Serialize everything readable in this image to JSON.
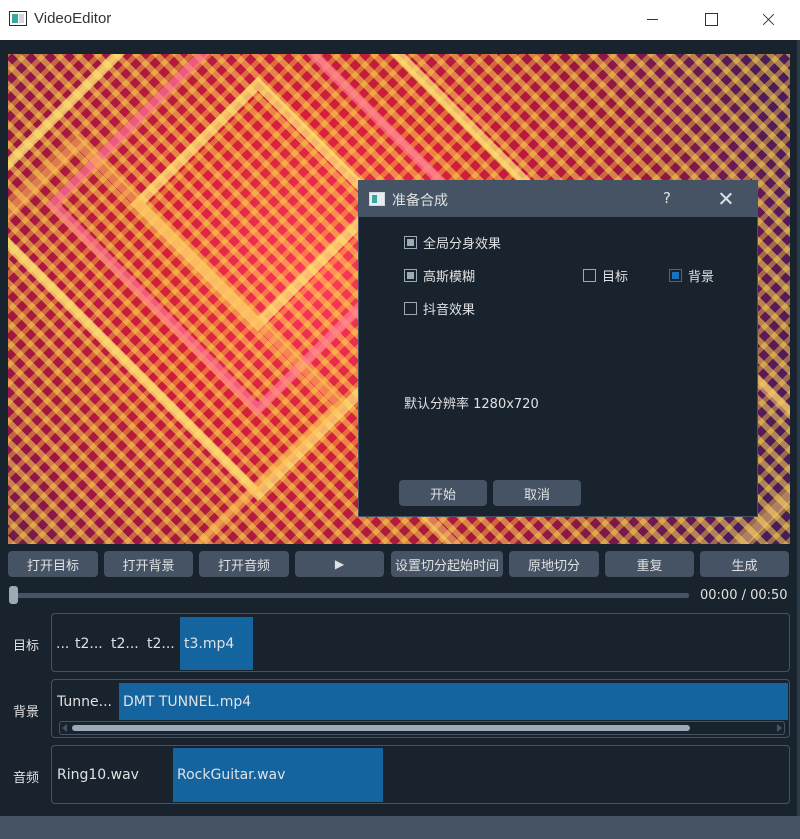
{
  "window": {
    "title": "VideoEditor"
  },
  "dialog": {
    "title": "准备合成",
    "help": "?",
    "checkboxes": [
      {
        "label": "全局分身效果",
        "state": "partial"
      },
      {
        "label": "高斯模糊",
        "state": "partial"
      },
      {
        "label": "目标",
        "state": "unchecked"
      },
      {
        "label": "背景",
        "state": "checked"
      },
      {
        "label": "抖音效果",
        "state": "unchecked"
      }
    ],
    "resolution_label": "默认分辨率 1280x720",
    "start_label": "开始",
    "cancel_label": "取消"
  },
  "toolbar": {
    "buttons": [
      "打开目标",
      "打开背景",
      "打开音频",
      "",
      "设置切分起始时间",
      "原地切分",
      "重复",
      "生成"
    ],
    "play_glyph": "▶"
  },
  "playback": {
    "time": "00:00 / 00:50",
    "position": 0.0
  },
  "tracks": [
    {
      "label": "目标",
      "clips": [
        "...",
        "t2...",
        "t2...",
        "t2...",
        "t3.mp4"
      ]
    },
    {
      "label": "背景",
      "clips": [
        "Tunne...",
        "DMT TUNNEL.mp4"
      ]
    },
    {
      "label": "音频",
      "clips": [
        "Ring10.wav",
        "RockGuitar.wav"
      ]
    }
  ],
  "colors": {
    "background": "#19232d",
    "panel": "#455364",
    "selection": "#1464a0",
    "text": "#e0e1e3"
  }
}
